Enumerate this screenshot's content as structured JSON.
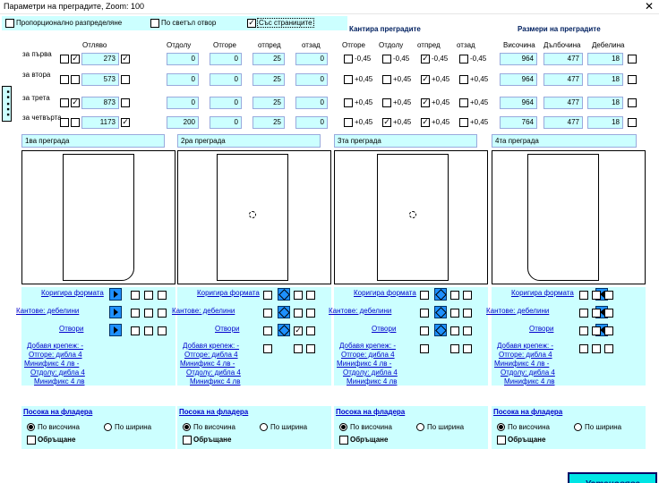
{
  "title": "Параметри на преградите, Zoom:  100",
  "close_glyph": "✕",
  "top": {
    "proportional": "Пропорционално разпределяне",
    "light": "По светъл отвор",
    "with_sides": "Със страниците",
    "with_sides_checked": true
  },
  "headers": {
    "from_left": "Отляво",
    "bottom": "Отдолу",
    "top": "Отгоре",
    "front": "отпред",
    "back": "отзад",
    "edges": "Кантира преградите",
    "edge_top": "Отгоре",
    "edge_bottom": "Отдолу",
    "edge_front": "отпред",
    "edge_back": "отзад",
    "sizes": "Размери на преградите",
    "height": "Височина",
    "depth": "Дълбочина",
    "thickness": "Дебелина"
  },
  "side_block": "■■ ■■■",
  "rows": [
    {
      "label": "за първа",
      "a": false,
      "b": true,
      "left": "273",
      "c": true,
      "bot": "0",
      "top": "0",
      "front": "25",
      "back": "0",
      "e1": "-0,45",
      "e2": "-0,45",
      "e3": "-0,45",
      "e4": "-0,45",
      "e3on": true,
      "h": "964",
      "d": "477",
      "t": "18"
    },
    {
      "label": "за втора",
      "a": false,
      "b": false,
      "left": "573",
      "c": false,
      "bot": "0",
      "top": "0",
      "front": "25",
      "back": "0",
      "e1": "+0,45",
      "e2": "+0,45",
      "e3": "+0,45",
      "e4": "+0,45",
      "e3on": true,
      "h": "964",
      "d": "477",
      "t": "18"
    },
    {
      "label": "за трета",
      "a": false,
      "b": true,
      "left": "873",
      "c": false,
      "bot": "0",
      "top": "0",
      "front": "25",
      "back": "0",
      "e1": "+0,45",
      "e2": "+0,45",
      "e3": "+0,45",
      "e4": "+0,45",
      "e3on": true,
      "h": "964",
      "d": "477",
      "t": "18"
    },
    {
      "label": "за четвърта",
      "a": false,
      "b": false,
      "left": "1173",
      "c": true,
      "bot": "200",
      "top": "0",
      "front": "25",
      "back": "0",
      "e1": "+0,45",
      "e2": "+0,45",
      "e3": "+0,45",
      "e4": "+0,45",
      "e2on": true,
      "e3on": true,
      "h": "764",
      "d": "477",
      "t": "18"
    }
  ],
  "panels": [
    {
      "name": "1ва преграда",
      "links": [
        "Коригира формата",
        "Кантове: дебелини",
        "Отвори",
        "Добавя крепеж: -",
        "Отгоре: дибла 4",
        "Минификс 4 лв -",
        "Отдолу: дибла 4",
        "Минификс 4 лв"
      ],
      "grain": "Посока на фладера",
      "by_height": "По височина",
      "by_width": "По ширина",
      "flip": "Обръщане"
    },
    {
      "name": "2ра преграда",
      "links": [
        "Коригира формата",
        "Кантове: дебелини",
        "Отвори",
        "Добавя крепеж: -",
        "Отгоре: дибла 4",
        "Минификс 4 лв -",
        "Отдолу: дибла 4",
        "Минификс 4 лв"
      ],
      "grain": "Посока на фладера",
      "by_height": "По височина",
      "by_width": "По ширина",
      "flip": "Обръщане"
    },
    {
      "name": "3та преграда",
      "links": [
        "Коригира формата",
        "Кантове: дебелини",
        "Отвори",
        "Добавя крепеж: -",
        "Отгоре: дибла 4",
        "Минификс 4 лв -",
        "Отдолу: дибла 4",
        "Минификс 4 лв"
      ],
      "grain": "Посока на фладера",
      "by_height": "По височина",
      "by_width": "По ширина",
      "flip": "Обръщане"
    },
    {
      "name": "4та преграда",
      "links": [
        "Коригира формата",
        "Кантове: дебелини",
        "Отвори",
        "Добавя крепеж: -",
        "Отгоре: дибла 4",
        "Минификс 4 лв -",
        "Отдолу: дибла 4",
        "Минификс 4 лв"
      ],
      "grain": "Посока на фладера",
      "by_height": "По височина",
      "by_width": "По ширина",
      "flip": "Обръщане"
    }
  ],
  "ok": "Установява"
}
